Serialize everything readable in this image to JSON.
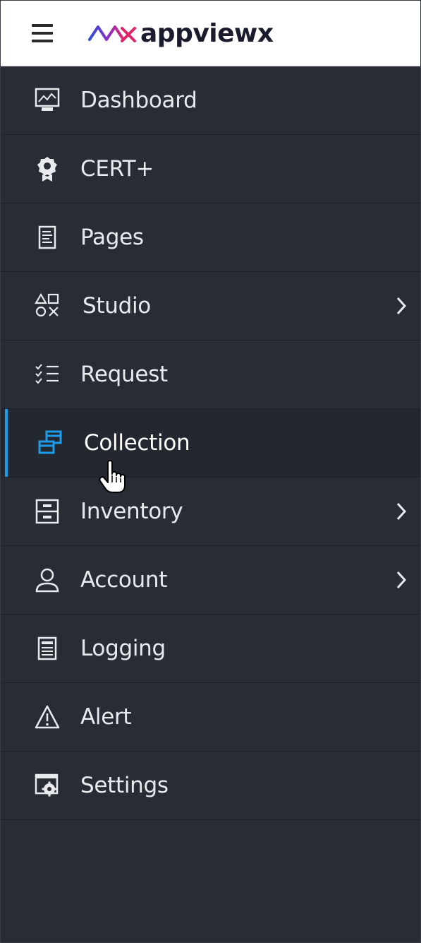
{
  "app": {
    "logo_text": "appviewx"
  },
  "menu": {
    "items": [
      {
        "label": "Dashboard",
        "icon": "monitor-chart-icon",
        "has_submenu": false
      },
      {
        "label": "CERT+",
        "icon": "badge-award-icon",
        "has_submenu": false
      },
      {
        "label": "Pages",
        "icon": "document-page-icon",
        "has_submenu": false
      },
      {
        "label": "Studio",
        "icon": "shapes-icon",
        "has_submenu": true
      },
      {
        "label": "Request",
        "icon": "checklist-icon",
        "has_submenu": false
      },
      {
        "label": "Collection",
        "icon": "stacked-windows-icon",
        "has_submenu": false,
        "active": true
      },
      {
        "label": "Inventory",
        "icon": "drawers-icon",
        "has_submenu": true
      },
      {
        "label": "Account",
        "icon": "user-icon",
        "has_submenu": true
      },
      {
        "label": "Logging",
        "icon": "log-icon",
        "has_submenu": false
      },
      {
        "label": "Alert",
        "icon": "warning-triangle-icon",
        "has_submenu": false
      },
      {
        "label": "Settings",
        "icon": "settings-window-gear-icon",
        "has_submenu": false
      }
    ]
  },
  "colors": {
    "sidebar_bg": "#282c34",
    "active_bg": "#232730",
    "accent": "#1e9be9",
    "text": "#e8eaee",
    "logo_gradient_start": "#2f4fd8",
    "logo_gradient_end": "#e4246a"
  }
}
